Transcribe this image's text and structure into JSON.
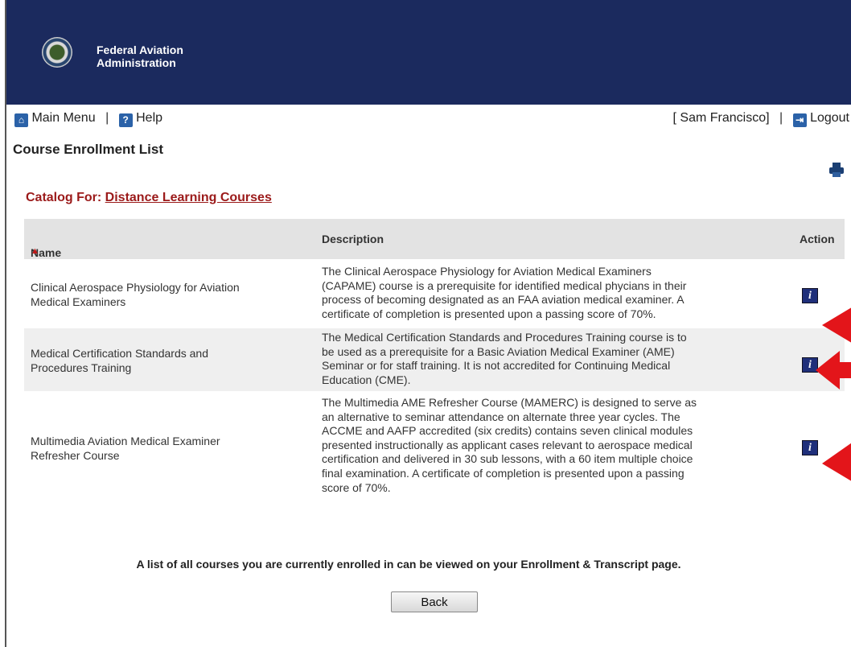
{
  "header": {
    "agency_line1": "Federal Aviation",
    "agency_line2": "Administration"
  },
  "nav": {
    "main_menu": "Main Menu",
    "help": "Help",
    "user": "[ Sam Francisco]",
    "logout": "Logout",
    "separator": "|"
  },
  "page": {
    "title": "Course Enrollment List",
    "catalog_label": "Catalog For:",
    "catalog_link": "Distance Learning Courses"
  },
  "table": {
    "headers": {
      "name": "Name",
      "description": "Description",
      "action": "Action"
    },
    "sort_indicator": "▲",
    "rows": [
      {
        "name": [
          "Clinical Aerospace Physiology for Aviation",
          "Medical Examiners"
        ],
        "description": [
          "The Clinical Aerospace Physiology for Aviation Medical Examiners",
          "(CAPAME) course is a prerequisite for identified medical phycians in their",
          "process of becoming designated as an FAA aviation medical examiner. A",
          "certificate of completion is presented upon a passing score of 70%."
        ]
      },
      {
        "name": [
          "Medical Certification Standards and",
          "Procedures Training"
        ],
        "description": [
          "The Medical Certification Standards and Procedures Training course is to",
          "be used as a prerequisite for a Basic Aviation Medical Examiner (AME)",
          "Seminar or for staff training. It is not accredited for Continuing Medical",
          "Education (CME)."
        ]
      },
      {
        "name": [
          "Multimedia Aviation Medical Examiner",
          "Refresher Course"
        ],
        "description": [
          "The Multimedia AME Refresher Course (MAMERC) is designed to serve as",
          "an alternative to seminar attendance on alternate three year cycles. The",
          "ACCME and AAFP accredited (six credits) contains seven clinical modules",
          "presented instructionally as applicant cases relevant to aerospace medical",
          "certification and delivered in 30 sub lessons, with a 60 item multiple choice",
          "final examination. A certificate of completion is presented upon a passing",
          "score of 70%."
        ]
      }
    ]
  },
  "footer": {
    "note": "A list of all courses you are currently enrolled in can be viewed on your Enrollment & Transcript page.",
    "back_label": "Back"
  },
  "colors": {
    "banner": "#1b2a5e",
    "catalog_red": "#9b1a1a",
    "header_row": "#e3e3e3",
    "stripe": "#efefef",
    "arrow_red": "#e3151a"
  }
}
